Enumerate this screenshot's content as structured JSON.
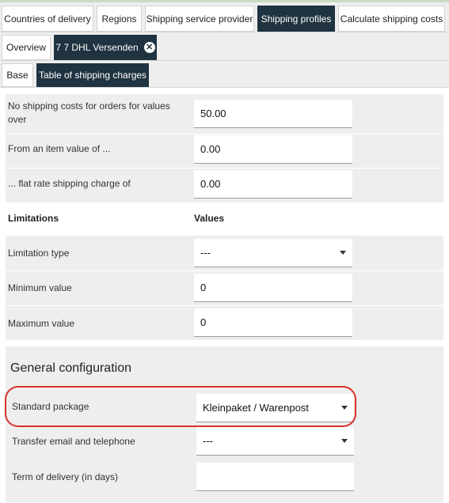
{
  "tabs_level1": [
    {
      "label": "Countries of delivery",
      "active": false
    },
    {
      "label": "Regions",
      "active": false
    },
    {
      "label": "Shipping service provider",
      "active": false
    },
    {
      "label": "Shipping profiles",
      "active": true
    },
    {
      "label": "Calculate shipping costs",
      "active": false
    }
  ],
  "tabs_level2": [
    {
      "label": "Overview",
      "active": false
    },
    {
      "label": "7 7 DHL Versenden",
      "active": true,
      "close_icon": "✕"
    }
  ],
  "tabs_level3": [
    {
      "label": "Base",
      "active": false
    },
    {
      "label": "Table of shipping charges",
      "active": true
    }
  ],
  "shipping": {
    "free_shipping_label": "No shipping costs for orders for values over",
    "free_shipping_value": "50.00",
    "item_value_label": "From an item value of ...",
    "item_value_value": "0.00",
    "flat_rate_label": "... flat rate shipping charge of",
    "flat_rate_value": "0.00"
  },
  "limitations": {
    "header_label": "Limitations",
    "header_values": "Values",
    "type_label": "Limitation type",
    "type_value": "---",
    "min_label": "Minimum value",
    "min_value": "0",
    "max_label": "Maximum value",
    "max_value": "0"
  },
  "general": {
    "title": "General configuration",
    "package_label": "Standard package",
    "package_value": "Kleinpaket / Warenpost",
    "transfer_label": "Transfer email and telephone",
    "transfer_value": "---",
    "term_label": "Term of delivery (in days)",
    "term_value": ""
  },
  "colors": {
    "active_tab": "#1f3340",
    "highlight": "#d9312b",
    "top_accent": "#c9dcc3"
  }
}
